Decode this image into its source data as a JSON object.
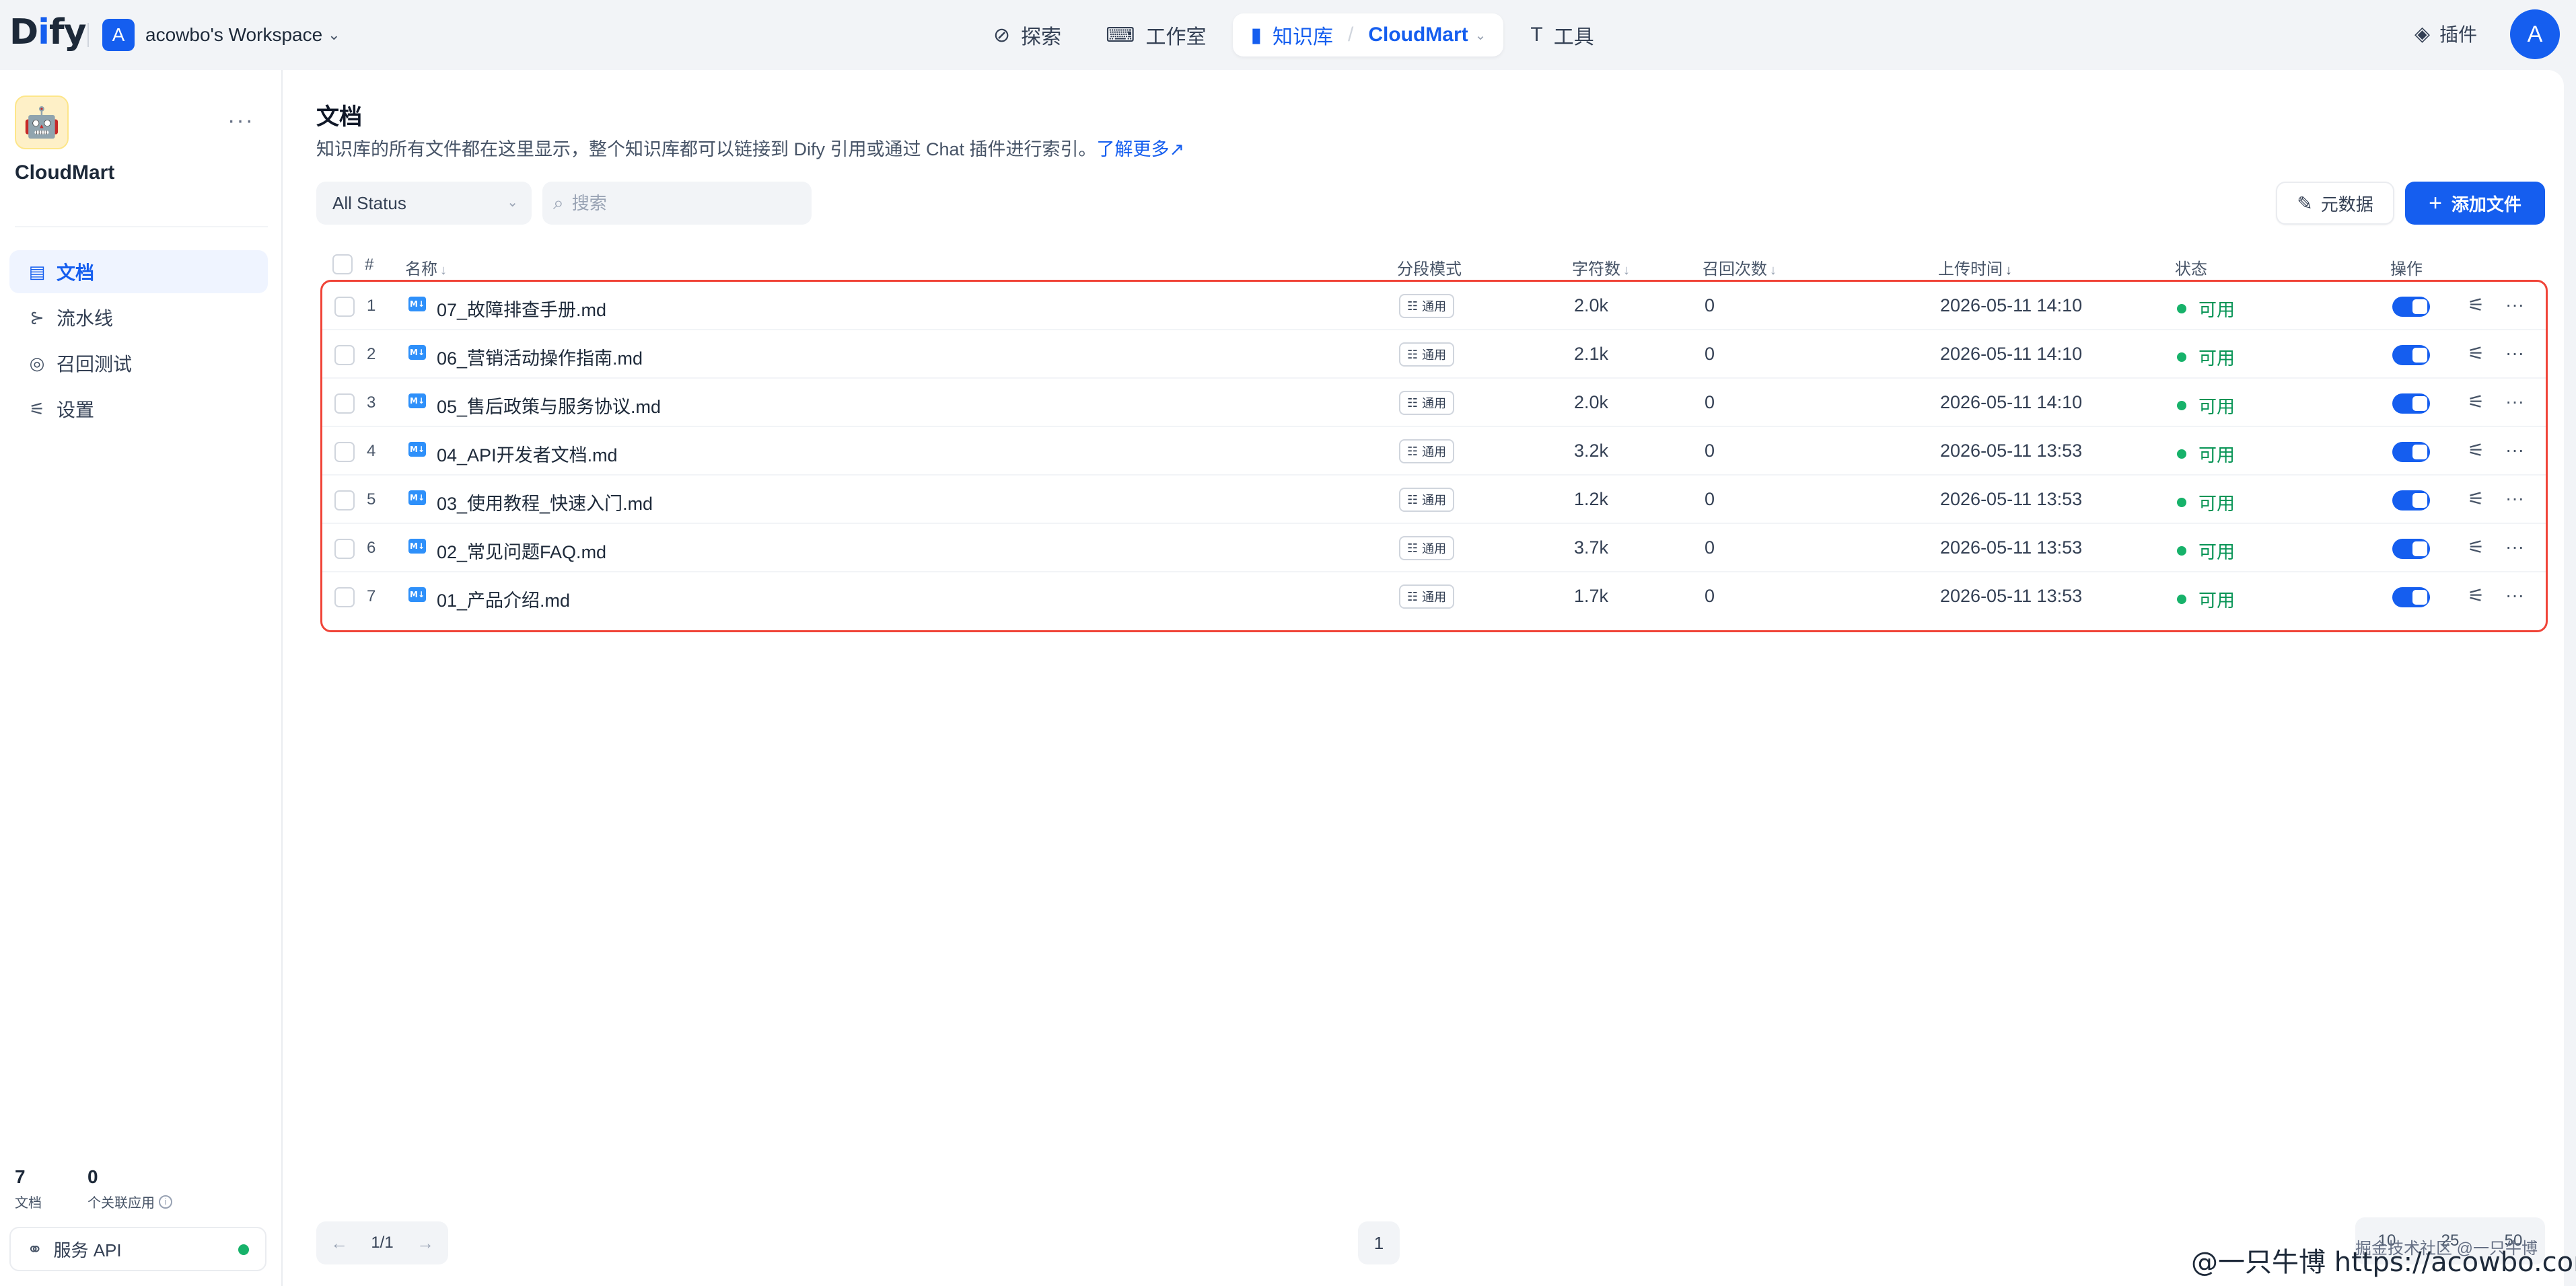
{
  "app": {
    "logo_text_a": "D",
    "logo_text_b": "i",
    "logo_text_c": "fy"
  },
  "workspace": {
    "avatar": "A",
    "name": "acowbo's Workspace"
  },
  "nav": {
    "items": [
      {
        "label": "探索",
        "icon": "compass-icon"
      },
      {
        "label": "工作室",
        "icon": "robot-icon"
      },
      {
        "label": "知识库",
        "icon": "book-icon",
        "sub": "CloudMart",
        "active": true
      },
      {
        "label": "工具",
        "icon": "hammer-icon"
      }
    ]
  },
  "header_right": {
    "plugin_label": "插件",
    "user_avatar": "A"
  },
  "sidebar": {
    "kb_name": "CloudMart",
    "menu": [
      {
        "label": "文档",
        "icon": "document-icon",
        "active": true
      },
      {
        "label": "流水线",
        "icon": "pipeline-icon"
      },
      {
        "label": "召回测试",
        "icon": "target-icon"
      },
      {
        "label": "设置",
        "icon": "settings-icon"
      }
    ],
    "stats": [
      {
        "value": "7",
        "label": "文档"
      },
      {
        "value": "0",
        "label": "个关联应用"
      }
    ],
    "api_label": "服务 API"
  },
  "page": {
    "title": "文档",
    "description": "知识库的所有文件都在这里显示，整个知识库都可以链接到 Dify 引用或通过 Chat 插件进行索引。",
    "learn_more": "了解更多"
  },
  "filters": {
    "status": "All Status",
    "search_placeholder": "搜索"
  },
  "buttons": {
    "metadata": "元数据",
    "add_file": "添加文件"
  },
  "table": {
    "columns": {
      "index": "#",
      "name": "名称",
      "mode": "分段模式",
      "chars": "字符数",
      "recall": "召回次数",
      "upload": "上传时间",
      "status": "状态",
      "action": "操作"
    },
    "rows": [
      {
        "index": "1",
        "name": "07_故障排查手册.md",
        "mode": "通用",
        "chars": "2.0k",
        "recall": "0",
        "upload": "2026-05-11 14:10",
        "status": "可用",
        "enabled": true
      },
      {
        "index": "2",
        "name": "06_营销活动操作指南.md",
        "mode": "通用",
        "chars": "2.1k",
        "recall": "0",
        "upload": "2026-05-11 14:10",
        "status": "可用",
        "enabled": true
      },
      {
        "index": "3",
        "name": "05_售后政策与服务协议.md",
        "mode": "通用",
        "chars": "2.0k",
        "recall": "0",
        "upload": "2026-05-11 14:10",
        "status": "可用",
        "enabled": true
      },
      {
        "index": "4",
        "name": "04_API开发者文档.md",
        "mode": "通用",
        "chars": "3.2k",
        "recall": "0",
        "upload": "2026-05-11 13:53",
        "status": "可用",
        "enabled": true
      },
      {
        "index": "5",
        "name": "03_使用教程_快速入门.md",
        "mode": "通用",
        "chars": "1.2k",
        "recall": "0",
        "upload": "2026-05-11 13:53",
        "status": "可用",
        "enabled": true
      },
      {
        "index": "6",
        "name": "02_常见问题FAQ.md",
        "mode": "通用",
        "chars": "3.7k",
        "recall": "0",
        "upload": "2026-05-11 13:53",
        "status": "可用",
        "enabled": true
      },
      {
        "index": "7",
        "name": "01_产品介绍.md",
        "mode": "通用",
        "chars": "1.7k",
        "recall": "0",
        "upload": "2026-05-11 13:53",
        "status": "可用",
        "enabled": true
      }
    ]
  },
  "pagination": {
    "page_info": "1/1",
    "current_page": "1",
    "per_page_options": [
      "10",
      "25",
      "50"
    ]
  },
  "watermark": {
    "text": "@一只牛博 https://acowbo.com",
    "community": "掘金技术社区 @一只牛博"
  },
  "colors": {
    "accent": "#155eef",
    "success": "#17b26a",
    "highlight": "#f04438"
  }
}
